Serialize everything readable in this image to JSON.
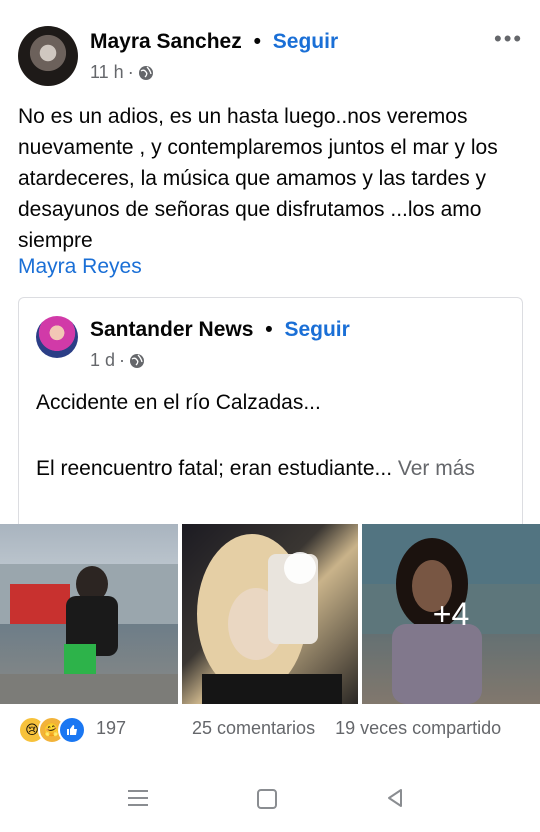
{
  "post": {
    "author": "Mayra Sanchez",
    "separator": "•",
    "follow_label": "Seguir",
    "time": "11 h",
    "time_sep": "·",
    "text": "No es un adios, es un hasta luego..nos veremos nuevamente , y contemplaremos juntos el mar y los atardeceres, la música que amamos y las tardes y desayunos de señoras que disfrutamos ...los amo siempre",
    "mention": "Mayra Reyes"
  },
  "shared": {
    "author": "Santander News",
    "separator": "•",
    "follow_label": "Seguir",
    "time": "1 d",
    "time_sep": "·",
    "line1": "Accidente en el  río Calzadas...",
    "line2": "El reencuentro fatal; eran estudiante...",
    "see_more": "Ver más"
  },
  "photos": {
    "extra_count": "+4"
  },
  "footer": {
    "reaction_count": "197",
    "comments": "25 comentarios",
    "shares": "19 veces compartido"
  },
  "icons": [
    "globe-icon",
    "more-options-icon",
    "sad-reaction-icon",
    "care-reaction-icon",
    "like-reaction-icon",
    "nav-menu-icon",
    "nav-home-icon",
    "nav-back-icon"
  ],
  "colors": {
    "accent": "#1a6fd6",
    "secondary_text": "#65676b"
  }
}
